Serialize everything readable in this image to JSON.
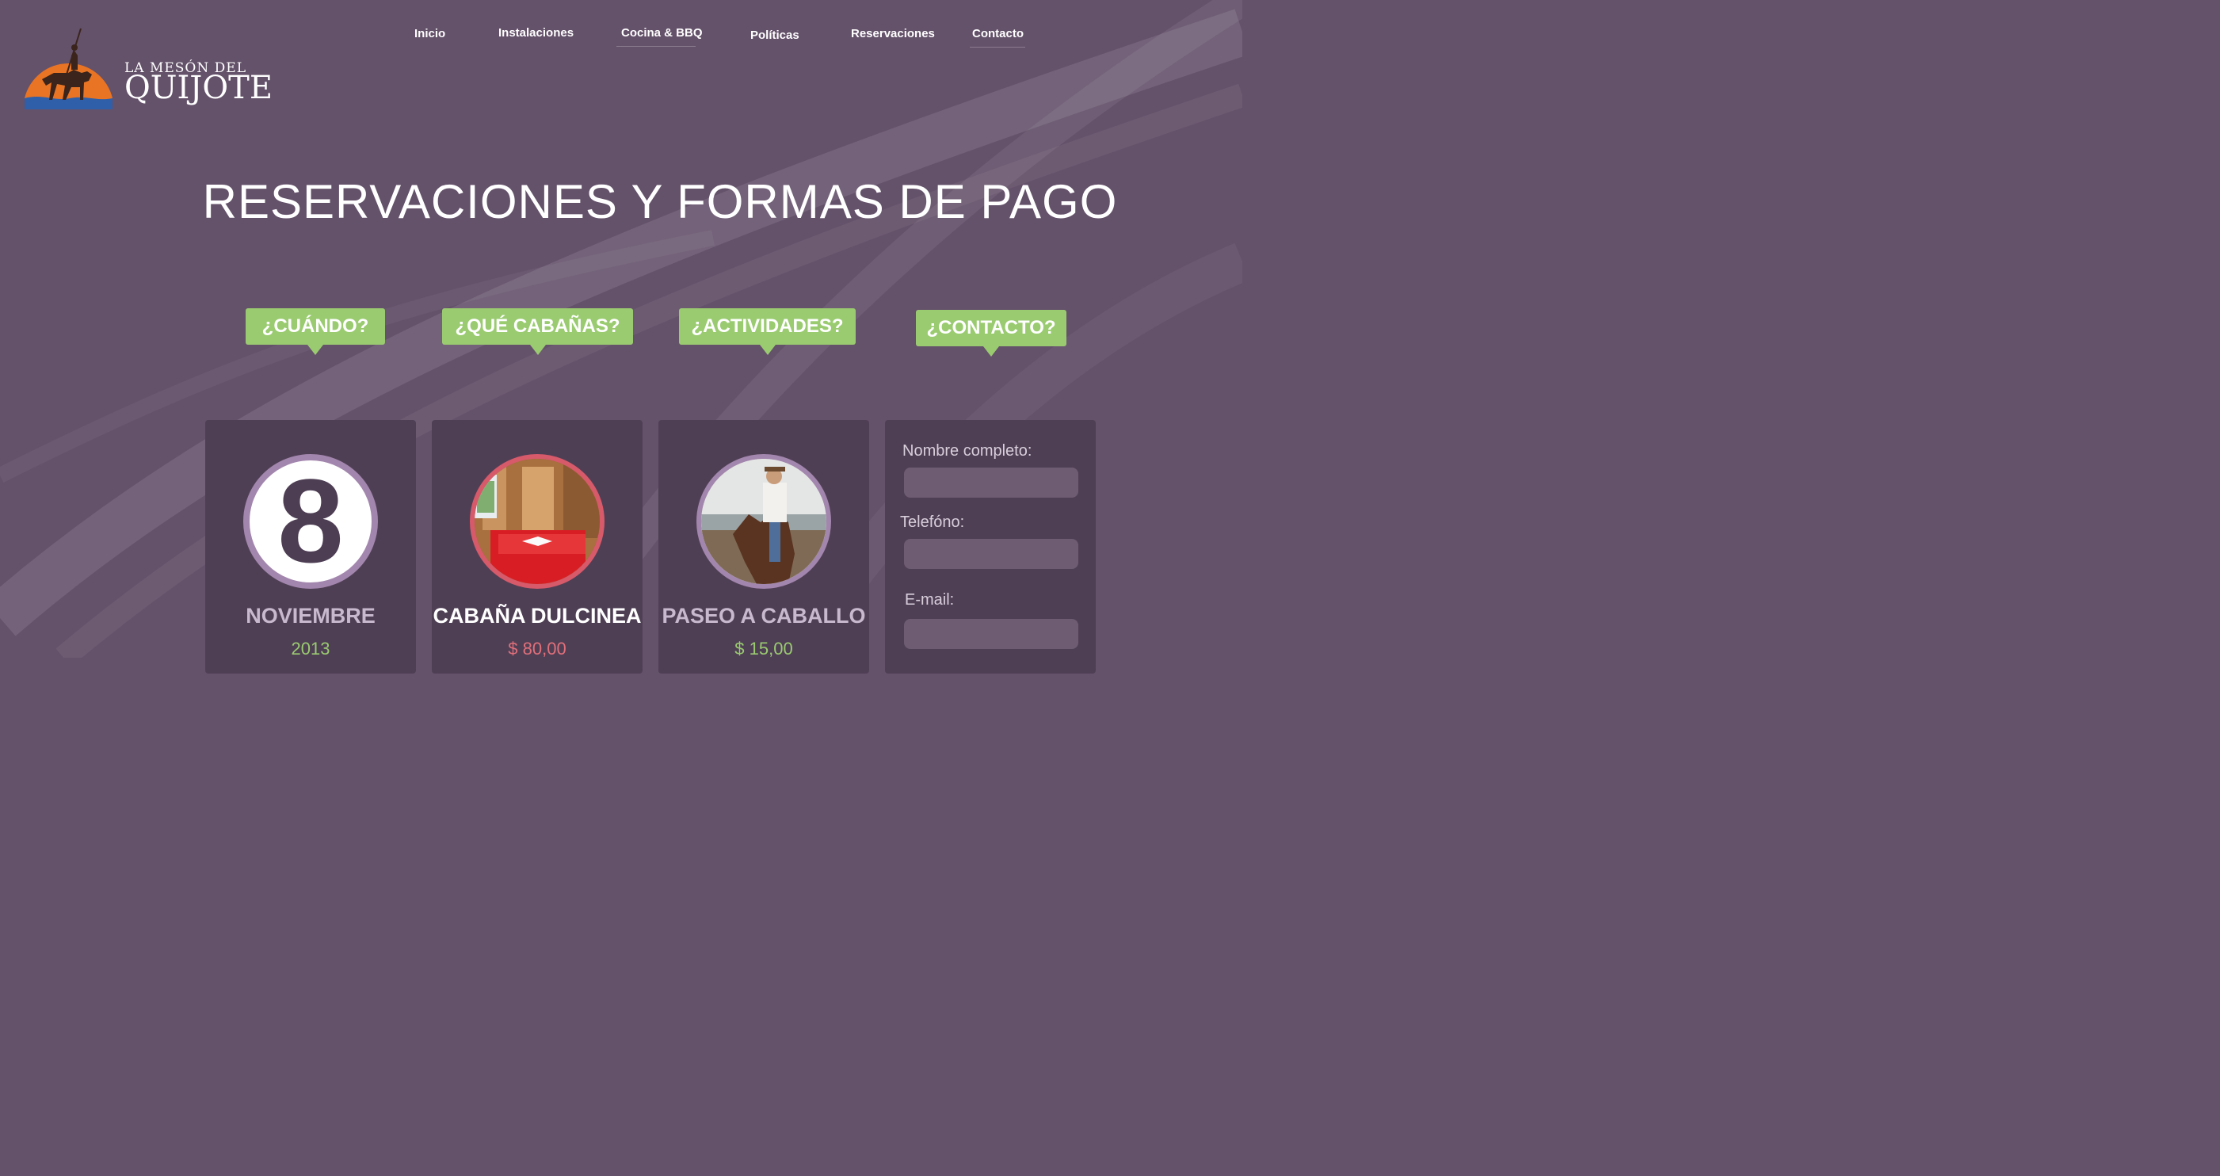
{
  "logo": {
    "line1": "LA MESÓN DEL",
    "line2": "QUIJOTE"
  },
  "nav": {
    "items": [
      "Inicio",
      "Instalaciones",
      "Cocina & BBQ",
      "Políticas",
      "Reservaciones",
      "Contacto"
    ]
  },
  "page_title": "RESERVACIONES Y FORMAS DE PAGO",
  "bubbles": [
    "¿CUÁNDO?",
    "¿QUÉ CABAÑAS?",
    "¿ACTIVIDADES?",
    "¿CONTACTO?"
  ],
  "cards": {
    "date": {
      "day": "8",
      "month": "NOVIEMBRE",
      "year": "2013"
    },
    "cabin": {
      "name": "CABAÑA DULCINEA",
      "price": "$ 80,00"
    },
    "activity": {
      "name": "PASEO A CABALLO",
      "price": "$ 15,00"
    }
  },
  "form": {
    "name_label": "Nombre completo:",
    "phone_label": "Telefóno:",
    "email_label": "E-mail:",
    "name_value": "",
    "phone_value": "",
    "email_value": ""
  },
  "colors": {
    "background": "#64516a",
    "card": "#4f3f55",
    "bubble": "#9acb70",
    "accent_green": "#9acb70",
    "accent_red": "#e0707a",
    "circle_border_purple": "#a386ad",
    "circle_border_red": "#d65a6a"
  }
}
